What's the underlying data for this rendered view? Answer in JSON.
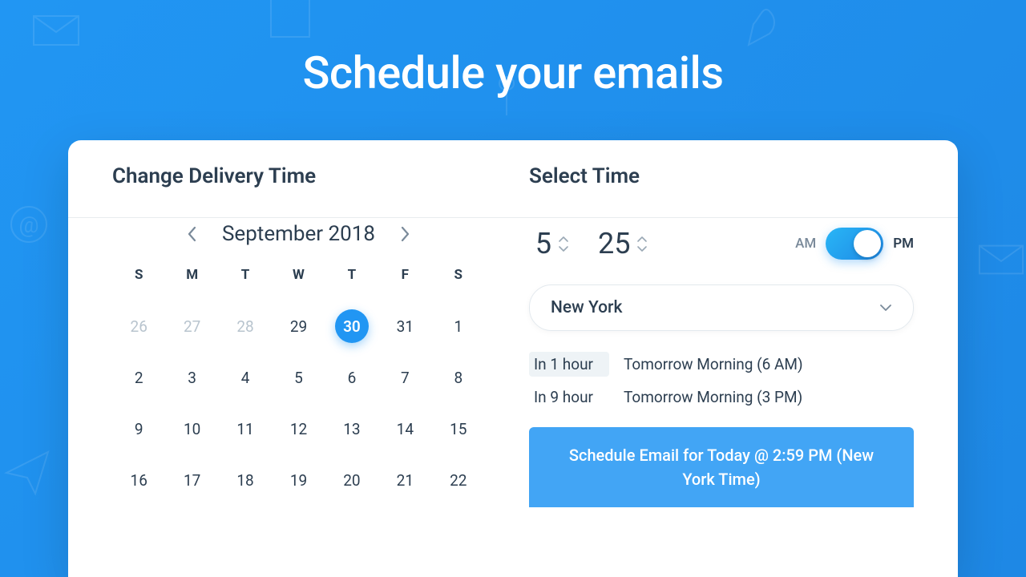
{
  "hero": {
    "title": "Schedule your emails"
  },
  "left": {
    "title": "Change Delivery Time",
    "month_label": "September 2018",
    "dow": [
      "S",
      "M",
      "T",
      "W",
      "T",
      "F",
      "S"
    ],
    "days": [
      {
        "n": "26",
        "muted": true
      },
      {
        "n": "27",
        "muted": true
      },
      {
        "n": "28",
        "muted": true
      },
      {
        "n": "29"
      },
      {
        "n": "30",
        "selected": true
      },
      {
        "n": "31"
      },
      {
        "n": "1"
      },
      {
        "n": "2"
      },
      {
        "n": "3"
      },
      {
        "n": "4"
      },
      {
        "n": "5"
      },
      {
        "n": "6"
      },
      {
        "n": "7"
      },
      {
        "n": "8"
      },
      {
        "n": "9"
      },
      {
        "n": "10"
      },
      {
        "n": "11"
      },
      {
        "n": "12"
      },
      {
        "n": "13"
      },
      {
        "n": "14"
      },
      {
        "n": "15"
      },
      {
        "n": "16"
      },
      {
        "n": "17"
      },
      {
        "n": "18"
      },
      {
        "n": "19"
      },
      {
        "n": "20"
      },
      {
        "n": "21"
      },
      {
        "n": "22"
      }
    ]
  },
  "right": {
    "title": "Select Time",
    "hour": "5",
    "minute": "25",
    "am_label": "AM",
    "pm_label": "PM",
    "ampm_selected": "PM",
    "timezone": "New York",
    "quick": [
      {
        "left": "In 1 hour",
        "right": "Tomorrow Morning (6 AM)",
        "highlight": true
      },
      {
        "left": "In 9 hour",
        "right": "Tomorrow Morning (3 PM)",
        "highlight": false
      }
    ],
    "schedule_button": "Schedule Email for Today @ 2:59 PM (New York Time)"
  }
}
